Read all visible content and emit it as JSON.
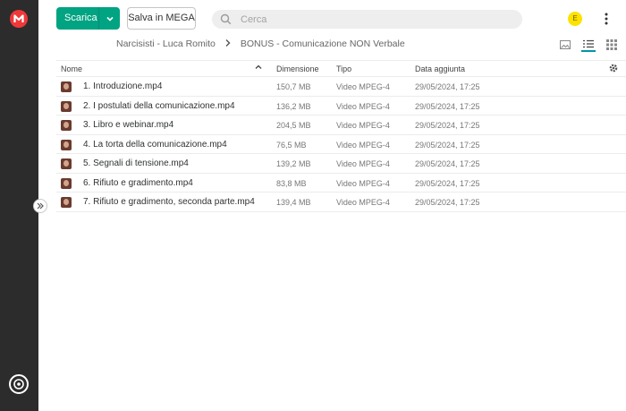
{
  "app": {
    "brand_color": "#f0373a"
  },
  "toolbar": {
    "download_label": "Scarica",
    "save_label": "Salva in MEGA",
    "accent": "#00a382"
  },
  "search": {
    "placeholder": "Cerca"
  },
  "user": {
    "badge": "E"
  },
  "breadcrumb": {
    "parent": "Narcisisti - Luca Romito",
    "current": "BONUS - Comunicazione NON Verbale"
  },
  "table": {
    "headers": {
      "name": "Nome",
      "size": "Dimensione",
      "type": "Tipo",
      "date": "Data aggiunta"
    },
    "rows": [
      {
        "name": "1. Introduzione.mp4",
        "size": "150,7 MB",
        "type": "Video MPEG-4",
        "date": "29/05/2024, 17:25"
      },
      {
        "name": "2. I postulati della comunicazione.mp4",
        "size": "136,2 MB",
        "type": "Video MPEG-4",
        "date": "29/05/2024, 17:25"
      },
      {
        "name": "3. Libro e webinar.mp4",
        "size": "204,5 MB",
        "type": "Video MPEG-4",
        "date": "29/05/2024, 17:25"
      },
      {
        "name": "4. La torta della comunicazione.mp4",
        "size": "76,5 MB",
        "type": "Video MPEG-4",
        "date": "29/05/2024, 17:25"
      },
      {
        "name": "5. Segnali di tensione.mp4",
        "size": "139,2 MB",
        "type": "Video MPEG-4",
        "date": "29/05/2024, 17:25"
      },
      {
        "name": "6. Rifiuto e gradimento.mp4",
        "size": "83,8 MB",
        "type": "Video MPEG-4",
        "date": "29/05/2024, 17:25"
      },
      {
        "name": "7. Rifiuto e gradimento, seconda parte.mp4",
        "size": "139,4 MB",
        "type": "Video MPEG-4",
        "date": "29/05/2024, 17:25"
      }
    ]
  }
}
